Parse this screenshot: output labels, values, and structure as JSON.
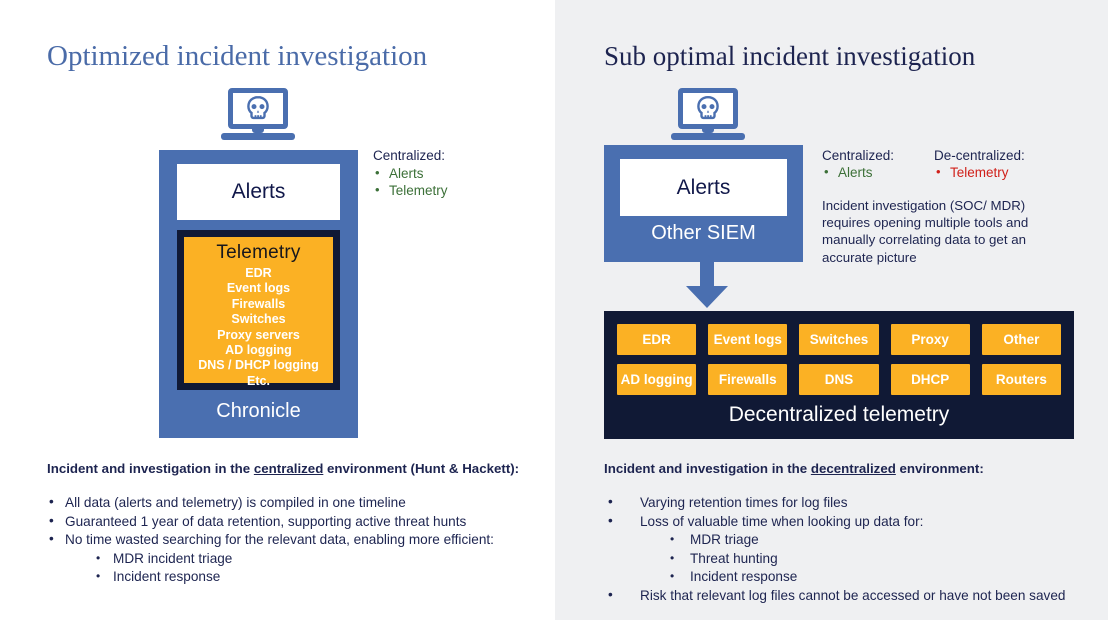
{
  "background": {
    "left_color": "#ffffff",
    "right_color": "#eff0f2"
  },
  "left": {
    "title": "Optimized incident investigation",
    "icon": "laptop-skull-icon",
    "alerts_label": "Alerts",
    "telemetry_title": "Telemetry",
    "telemetry_items": [
      "EDR",
      "Event logs",
      "Firewalls",
      "Switches",
      "Proxy servers",
      "AD logging",
      "DNS / DHCP logging",
      "Etc."
    ],
    "platform_label": "Chronicle",
    "legend": {
      "centralized_heading": "Centralized:",
      "centralized_items": [
        "Alerts",
        "Telemetry"
      ],
      "centralized_color": "#3c7038"
    },
    "body": {
      "heading_pre": "Incident and investigation in the ",
      "heading_underlined": "centralized",
      "heading_post": " environment (Hunt & Hackett):",
      "bullets": [
        {
          "level": 1,
          "text": "All data (alerts and telemetry) is compiled in one timeline"
        },
        {
          "level": 1,
          "text": "Guaranteed 1 year of data retention, supporting active threat hunts"
        },
        {
          "level": 1,
          "text": "No time wasted searching for the relevant data, enabling more efficient:"
        },
        {
          "level": 2,
          "text": "MDR incident triage"
        },
        {
          "level": 2,
          "text": "Incident response"
        }
      ]
    }
  },
  "right": {
    "title": "Sub optimal incident investigation",
    "icon": "laptop-skull-icon",
    "alerts_label": "Alerts",
    "siem_label": "Other SIEM",
    "arrow": "down-arrow-icon",
    "legend": {
      "centralized_heading": "Centralized:",
      "centralized_items": [
        "Alerts"
      ],
      "centralized_color": "#3c7038",
      "decentralized_heading": "De-centralized:",
      "decentralized_items": [
        "Telemetry"
      ],
      "decentralized_color": "#d0201a"
    },
    "note": "Incident investigation (SOC/ MDR) requires opening multiple tools and manually correlating data to get an accurate picture",
    "tiles": [
      "EDR",
      "Event logs",
      "Switches",
      "Proxy",
      "Other",
      "AD logging",
      "Firewalls",
      "DNS",
      "DHCP",
      "Routers"
    ],
    "panel_caption": "Decentralized telemetry",
    "body": {
      "heading_pre": "Incident and investigation in the ",
      "heading_underlined": "decentralized",
      "heading_post": " environment:",
      "bullets": [
        {
          "level": 1,
          "text": "Varying retention times for log files"
        },
        {
          "level": 1,
          "text": "Loss of valuable time when looking up data for:"
        },
        {
          "level": 2,
          "text": "MDR triage"
        },
        {
          "level": 2,
          "text": "Threat hunting"
        },
        {
          "level": 2,
          "text": "Incident response"
        },
        {
          "level": 1,
          "text": "Risk that relevant log files cannot be accessed or have not been saved"
        }
      ]
    }
  },
  "colors": {
    "blue": "#4a6fb0",
    "orange": "#fbb124",
    "navy": "#101935",
    "title_blue": "#4a6ba8",
    "title_navy": "#1d2450"
  }
}
